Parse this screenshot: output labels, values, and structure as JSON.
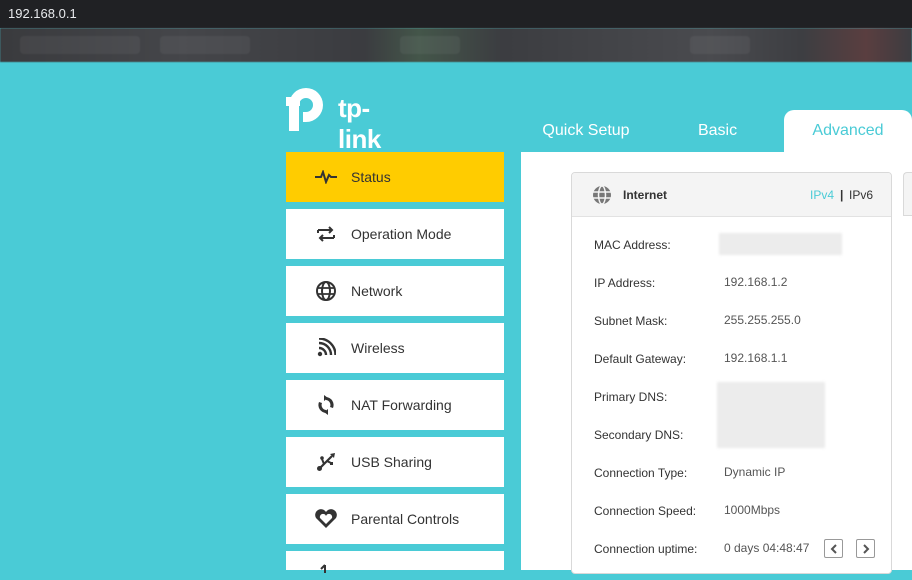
{
  "browser": {
    "url": "192.168.0.1"
  },
  "brand": {
    "name": "tp-link",
    "accent": "#4acbd6",
    "active_color": "#ffcc00"
  },
  "tabs": [
    {
      "label": "Quick Setup"
    },
    {
      "label": "Basic"
    },
    {
      "label": "Advanced",
      "active": true
    }
  ],
  "sidebar": {
    "items": [
      {
        "label": "Status",
        "icon": "pulse-icon",
        "active": true
      },
      {
        "label": "Operation Mode",
        "icon": "swap-arrows-icon"
      },
      {
        "label": "Network",
        "icon": "globe-icon"
      },
      {
        "label": "Wireless",
        "icon": "wifi-icon"
      },
      {
        "label": "NAT Forwarding",
        "icon": "refresh-icon"
      },
      {
        "label": "USB Sharing",
        "icon": "usb-icon"
      },
      {
        "label": "Parental Controls",
        "icon": "heart-icon"
      }
    ]
  },
  "internet_card": {
    "title": "Internet",
    "ipv4": "IPv4",
    "separator": "|",
    "ipv6": "IPv6",
    "rows": [
      {
        "label": "MAC Address:",
        "value": ""
      },
      {
        "label": "IP Address:",
        "value": "192.168.1.2"
      },
      {
        "label": "Subnet Mask:",
        "value": "255.255.255.0"
      },
      {
        "label": "Default Gateway:",
        "value": "192.168.1.1"
      },
      {
        "label": "Primary DNS:",
        "value": ""
      },
      {
        "label": "Secondary DNS:",
        "value": ""
      },
      {
        "label": "Connection Type:",
        "value": "Dynamic IP"
      },
      {
        "label": "Connection Speed:",
        "value": "1000Mbps"
      },
      {
        "label": "Connection uptime:",
        "value": "0 days 04:48:47"
      }
    ]
  }
}
